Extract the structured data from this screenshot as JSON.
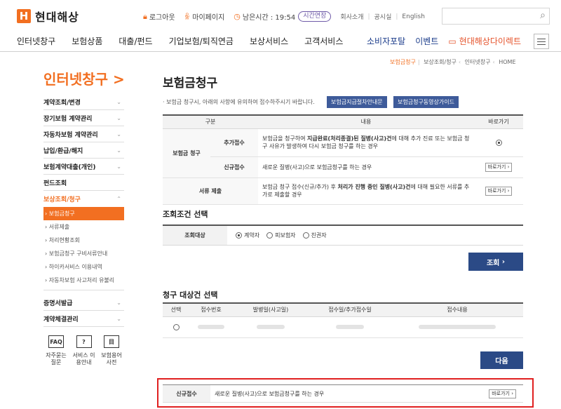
{
  "brand": {
    "name": "현대해상",
    "mark": "H",
    "color": "#f26f21"
  },
  "util": {
    "logout": "로그아웃",
    "mypage": "마이페이지",
    "time_label": "남은시간 : 19:54",
    "extend": "시간연장",
    "about": "회사소개",
    "notice": "공시실",
    "english": "English"
  },
  "gnb": {
    "items": [
      "인터넷창구",
      "보험상품",
      "대출/펀드",
      "기업보험/퇴직연금",
      "보상서비스",
      "고객서비스"
    ],
    "portal": "소비자포탈",
    "event": "이벤트",
    "direct": "현대해상다이렉트"
  },
  "sidebar": {
    "title": "인터넷창구 >",
    "items": [
      "계약조회/변경",
      "장기보험 계약관리",
      "자동차보험 계약관리",
      "납입/환급/해지",
      "보험계약대출(개인)",
      "펀드조회"
    ],
    "active": "보상조회/청구",
    "subs": [
      "보험금청구",
      "서류제출",
      "처리현황조회",
      "보험금청구 구비서류안내",
      "하이카서비스 이용내역",
      "자동차보험 사고처리 유불리"
    ],
    "after": [
      "증명서발급",
      "계약체결관리"
    ],
    "quick": [
      {
        "icon": "FAQ",
        "label": "자주묻는 질문"
      },
      {
        "icon": "?",
        "label": "서비스 이용안내"
      },
      {
        "icon": "目",
        "label": "보험용어 사전"
      }
    ]
  },
  "breadcrumb": [
    "보험금청구",
    "보상조회/청구",
    "인터넷창구",
    "HOME"
  ],
  "page": {
    "title": "보험금청구",
    "notice": "보험금 청구시, 아래의 사항에 유의하여 접수하주시기 바랍니다.",
    "guide1": "보험금지급절차안내문",
    "guide2": "보험금청구동영상가이드"
  },
  "claim_table": {
    "headers": [
      "구분",
      "내용",
      "바로가기"
    ],
    "group1": "보험금 청구",
    "row1_label": "추가접수",
    "row1_desc_a": "보험금을 청구하여 ",
    "row1_desc_b": "지급완료(처리종결)된 질병(사고)건",
    "row1_desc_c": "에 대해 추가 진료 또는 보험금 청구 사유가 발생하여 다시 보험금 청구를 하는 경우",
    "row2_label": "신규접수",
    "row2_desc": "새로운 질병(사고)으로 보험금청구를 하는 경우",
    "row3_label": "서류 제출",
    "row3_desc_a": "보험금 청구 접수(신규/추가) 후 ",
    "row3_desc_b": "처리가 진행 중인 질병(사고)건",
    "row3_desc_c": "에 대해 필요한 서류를 추가로 제출할 경우",
    "go": "바로가기"
  },
  "condition": {
    "title": "조회조건 선택",
    "key": "조회대상",
    "options": [
      "계약자",
      "피보험자",
      "친권자"
    ],
    "search_btn": "조회"
  },
  "target": {
    "title": "청구 대상건 선택",
    "headers": [
      "선택",
      "접수번호",
      "발병일(사고일)",
      "접수일/추가접수일",
      "접수내용"
    ],
    "next_btn": "다음"
  },
  "highlight": {
    "label": "신규접수",
    "desc": "새로운 질병(사고)으로 보험금청구를 하는 경우",
    "go": "바로가기"
  }
}
